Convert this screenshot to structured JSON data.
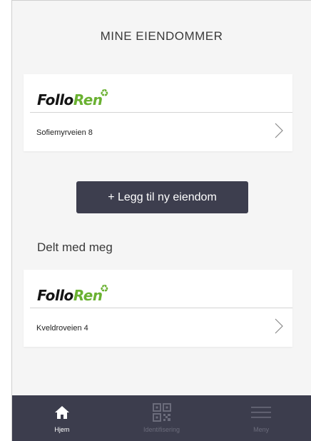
{
  "header": {
    "title": "MINE EIENDOMMER"
  },
  "properties": [
    {
      "logo_part1": "Follo",
      "logo_part2": "Ren",
      "address": "Sofiemyrveien 8"
    }
  ],
  "actions": {
    "add_property_label": "+ Legg til ny eiendom"
  },
  "shared": {
    "heading": "Delt med meg",
    "properties": [
      {
        "logo_part1": "Follo",
        "logo_part2": "Ren",
        "address": "Kveldroveien 4"
      }
    ]
  },
  "tabbar": {
    "tabs": [
      {
        "label": "Hjem",
        "icon": "home-icon",
        "active": true
      },
      {
        "label": "Identifisering",
        "icon": "qr-code-icon",
        "active": false
      },
      {
        "label": "Meny",
        "icon": "hamburger-menu-icon",
        "active": false
      }
    ]
  },
  "colors": {
    "brand_green": "#6ab131",
    "tabbar_bg": "#3c3d4d",
    "button_bg": "#3d3e4e",
    "inactive_tab": "#6b6c7b"
  }
}
